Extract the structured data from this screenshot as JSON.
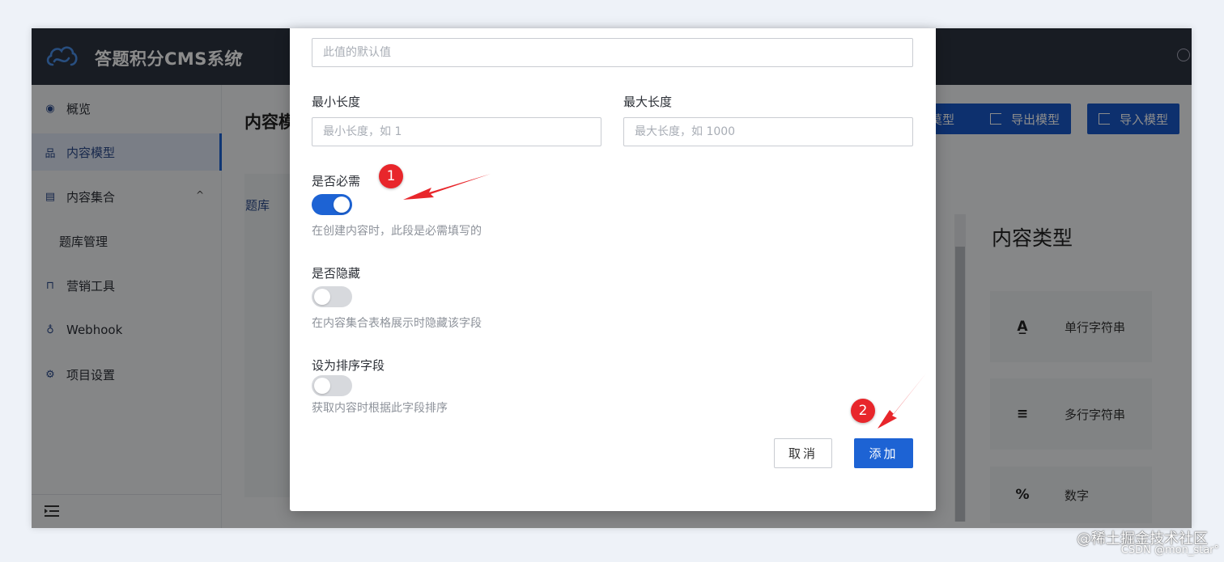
{
  "app": {
    "title": "答题积分CMS系统",
    "caret": "▾"
  },
  "sidebar": {
    "items": [
      {
        "label": "概览",
        "icon": "eye-icon"
      },
      {
        "label": "内容模型",
        "icon": "sitemap-icon"
      },
      {
        "label": "内容集合",
        "icon": "list-icon"
      },
      {
        "label": "题库管理",
        "icon": ""
      },
      {
        "label": "营销工具",
        "icon": "bag-icon"
      },
      {
        "label": "Webhook",
        "icon": "webhook-icon"
      },
      {
        "label": "项目设置",
        "icon": "gear-icon"
      }
    ],
    "chevron": "^"
  },
  "main": {
    "title": "内容模",
    "toolbar": {
      "btn_partial": "莫型",
      "export_label": "导出模型",
      "import_label": "导入模型"
    },
    "tab": "题库",
    "type_panel": {
      "heading": "内容类型",
      "cards": [
        {
          "icon": "A̲",
          "label": "单行字符串"
        },
        {
          "icon": "≡",
          "label": "多行字符串"
        },
        {
          "icon": "%",
          "label": "数字"
        }
      ]
    }
  },
  "modal": {
    "default_value_placeholder": "此值的默认值",
    "min_length_label": "最小长度",
    "min_length_placeholder": "最小长度，如 1",
    "max_length_label": "最大长度",
    "max_length_placeholder": "最大长度，如 1000",
    "required": {
      "label": "是否必需",
      "desc": "在创建内容时，此段是必需填写的",
      "on": true
    },
    "hidden": {
      "label": "是否隐藏",
      "desc": "在内容集合表格展示时隐藏该字段",
      "on": false
    },
    "sort": {
      "label": "设为排序字段",
      "desc": "获取内容时根据此字段排序",
      "on": false
    },
    "cancel_label": "取消",
    "add_label": "添加"
  },
  "annotations": {
    "badge1": "1",
    "badge2": "2",
    "color": "#e8262b"
  },
  "watermark": {
    "line1": "@稀土掘金技术社区",
    "line2": "CSDN @mon_star°"
  }
}
